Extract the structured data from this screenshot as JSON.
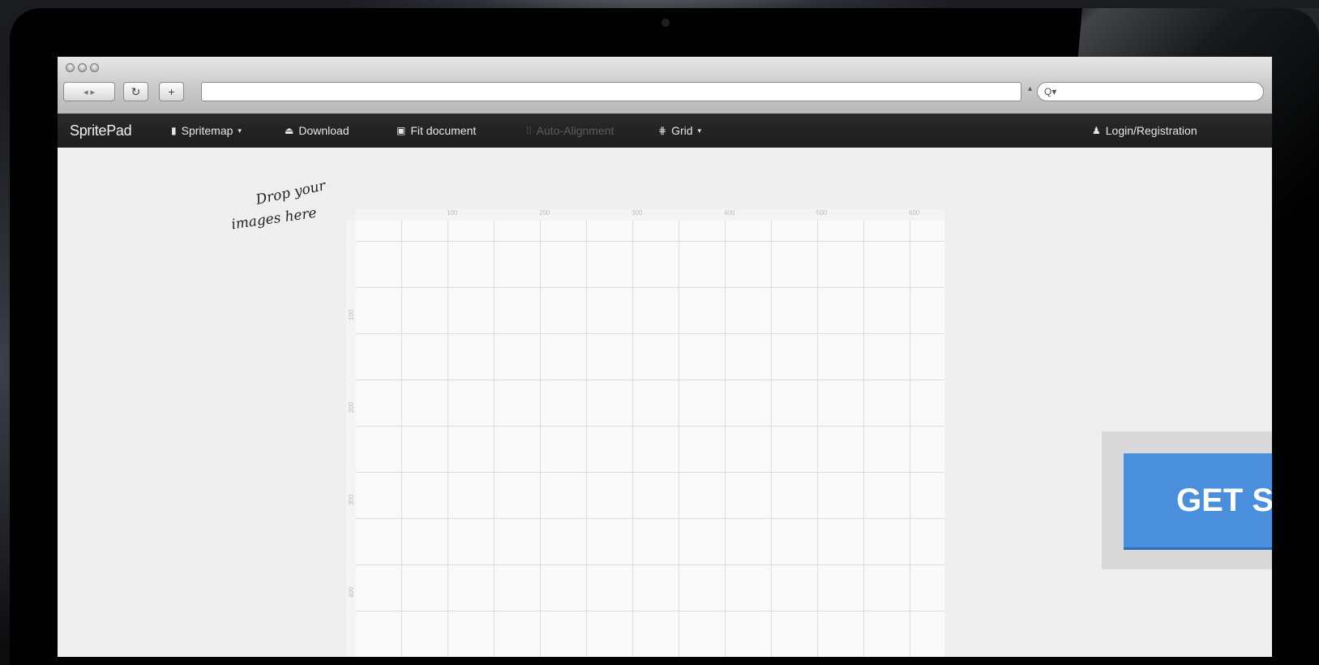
{
  "browser": {
    "back_forward_label": "◂ ▸",
    "reload_label": "↻",
    "new_tab_label": "+",
    "search_placeholder": "Q▾"
  },
  "app": {
    "brand": "SpritePad",
    "toolbar": {
      "spritemap": "Spritemap",
      "download": "Download",
      "fit_document": "Fit document",
      "auto_alignment": "Auto-Alignment",
      "grid": "Grid",
      "login": "Login/Registration"
    }
  },
  "canvas": {
    "drop_hint_line1": "Drop your",
    "drop_hint_line2": "images here",
    "ruler_top": [
      "100",
      "200",
      "300",
      "400",
      "500",
      "600"
    ],
    "ruler_left": [
      "100",
      "200",
      "300",
      "400"
    ]
  },
  "cta": {
    "label": "GET S"
  },
  "colors": {
    "toolbar_bg": "#1d1d1d",
    "cta_blue": "#4a8fdc",
    "workspace_bg": "#efefef"
  }
}
